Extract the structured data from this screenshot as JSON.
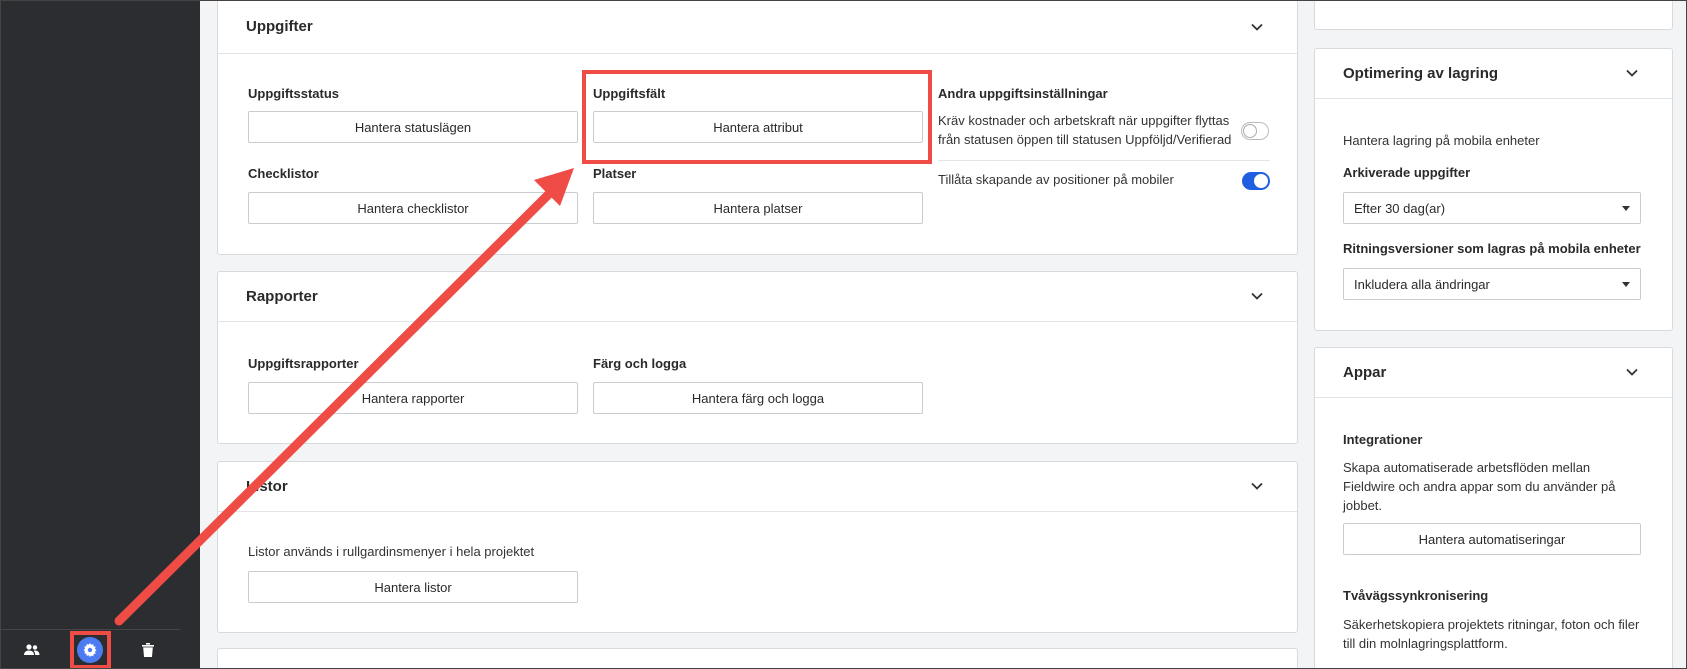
{
  "sidebar": {
    "icons": [
      {
        "name": "people-icon"
      },
      {
        "name": "gear-icon",
        "active": true
      },
      {
        "name": "trash-icon"
      }
    ]
  },
  "tasks_card": {
    "title": "Uppgifter",
    "status": {
      "label": "Uppgiftsstatus",
      "button": "Hantera statuslägen"
    },
    "fields": {
      "label": "Uppgiftsfält",
      "button": "Hantera attribut"
    },
    "checklists": {
      "label": "Checklistor",
      "button": "Hantera checklistor"
    },
    "locations": {
      "label": "Platser",
      "button": "Hantera platser"
    },
    "other": {
      "label": "Andra uppgiftsinställningar",
      "setting1_line1": "Kräv kostnader och arbetskraft när uppgifter flyttas",
      "setting1_line2": "från statusen öppen till statusen Uppföljd/Verifierad",
      "setting1_enabled": false,
      "setting2": "Tillåta skapande av positioner på mobiler",
      "setting2_enabled": true
    }
  },
  "reports_card": {
    "title": "Rapporter",
    "task_reports": {
      "label": "Uppgiftsrapporter",
      "button": "Hantera rapporter"
    },
    "color_logo": {
      "label": "Färg och logga",
      "button": "Hantera färg och logga"
    }
  },
  "lists_card": {
    "title": "Listor",
    "description": "Listor används i rullgardinsmenyer i hela projektet",
    "button": "Hantera listor"
  },
  "storage_card": {
    "title": "Optimering av lagring",
    "description": "Hantera lagring på mobila enheter",
    "archived": {
      "label": "Arkiverade uppgifter",
      "value": "Efter 30 dag(ar)"
    },
    "drawings": {
      "label": "Ritningsversioner som lagras på mobila enheter",
      "value": "Inkludera alla ändringar"
    }
  },
  "apps_card": {
    "title": "Appar",
    "integrations": {
      "label": "Integrationer",
      "line1": "Skapa automatiserade arbetsflöden mellan",
      "line2": "Fieldwire och andra appar som du använder på",
      "line3": "jobbet.",
      "button": "Hantera automatiseringar"
    },
    "sync": {
      "label": "Tvåvägssynkronisering",
      "line1": "Säkerhetskopiera projektets ritningar, foton och filer",
      "line2": "till din molnlagringsplattform."
    }
  },
  "annotation_color": "#ee4c45"
}
